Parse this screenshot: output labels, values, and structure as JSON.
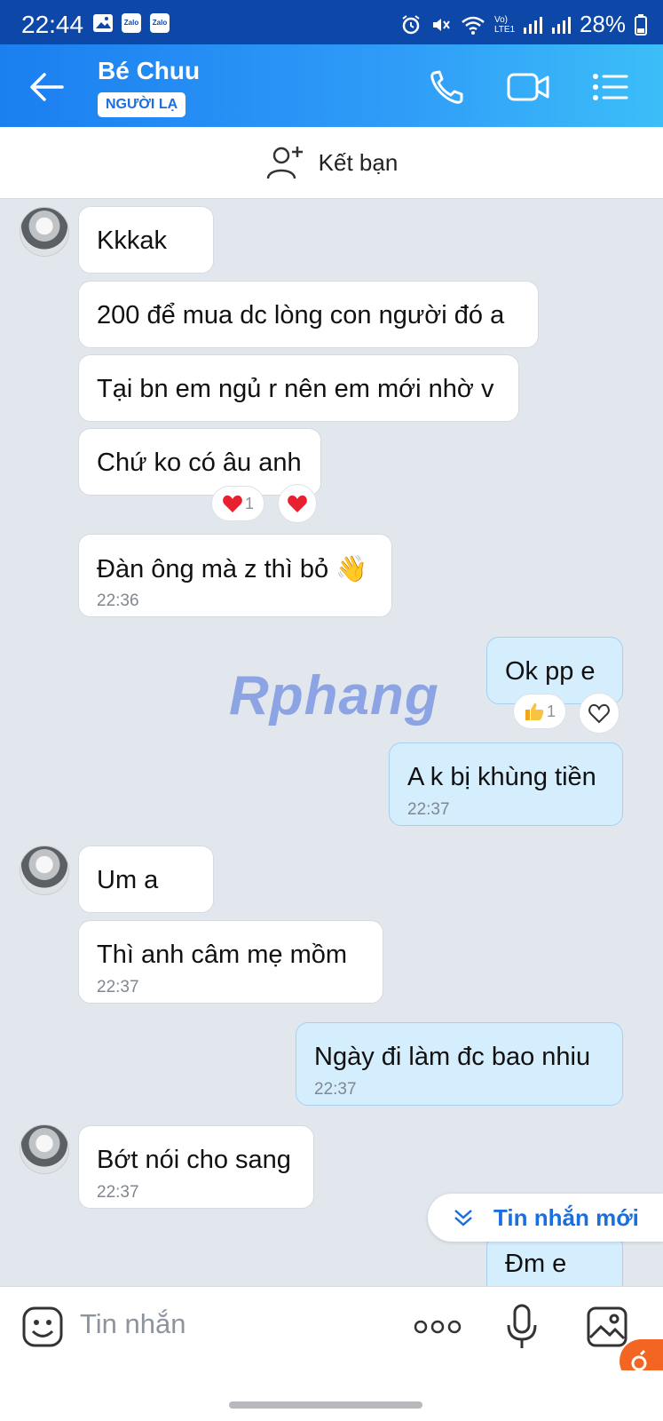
{
  "status_bar": {
    "time": "22:44",
    "battery": "28%",
    "app_icon_labels": [
      "Zalo",
      "Zalo"
    ],
    "network_label": "Vo) LTE1"
  },
  "header": {
    "contact_name": "Bé Chuu",
    "badge": "NGƯỜI LẠ"
  },
  "friend_bar": {
    "label": "Kết bạn"
  },
  "messages": [
    {
      "text": "Kkkak"
    },
    {
      "text": "200 để mua dc lòng con người đó a"
    },
    {
      "text": "Tại bn em ngủ r nên em mới nhờ v"
    },
    {
      "text": "Chứ ko có âu anh",
      "reaction_count": "1"
    },
    {
      "text": "Đàn ông mà z thì bỏ 👋",
      "time": "22:36"
    },
    {
      "text": "Ok pp e",
      "reaction_count": "1"
    },
    {
      "text": "A k bị khùng tiền",
      "time": "22:37"
    },
    {
      "text": "Um a"
    },
    {
      "text": "Thì anh câm mẹ mồm",
      "time": "22:37"
    },
    {
      "text": "Ngày đi làm đc bao nhiu",
      "time": "22:37"
    },
    {
      "text": "Bớt nói cho sang",
      "time": "22:37"
    },
    {
      "text": "Đm e"
    }
  ],
  "watermark": "Rphang",
  "new_message_button": {
    "label": "Tin nhắn mới"
  },
  "input": {
    "placeholder": "Tin nhắn"
  },
  "colors": {
    "header_start": "#1b7ff0",
    "header_end": "#3cbef8",
    "sent_bubble": "#d5eefe",
    "received_bubble": "#ffffff",
    "chat_bg": "#e2e7ee",
    "accent": "#1a6fe0"
  }
}
